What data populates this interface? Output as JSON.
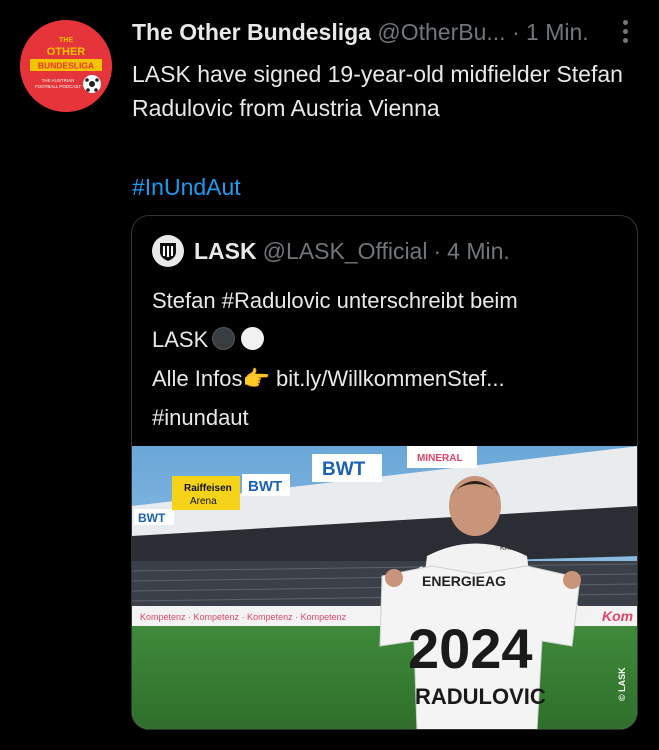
{
  "tweet": {
    "author_name": "The Other Bundesliga",
    "handle": "@OtherBu...",
    "separator": "·",
    "time": "1 Min.",
    "text": "LASK have signed 19-year-old midfielder Stefan Radulovic from Austria Vienna",
    "hashtag": "#InUndAut",
    "avatar_logo": {
      "line1": "THE",
      "line2": "OTHER",
      "line3": "BUNDESLIGA",
      "line4": "THE AUSTRIAN",
      "line5": "FOOTBALL PODCAST"
    }
  },
  "quoted": {
    "author_name": "LASK",
    "handle": "@LASK_Official",
    "separator": "·",
    "time": "4 Min.",
    "line1": "Stefan #Radulovic unterschreibt beim",
    "line2": "LASK",
    "line3_prefix": "Alle Infos",
    "pointing_emoji": "👉",
    "link": "bit.ly/WillkommenStef...",
    "line4": "#inundaut",
    "photo": {
      "sponsor_bwt": "BWT",
      "sponsor_raiffeisen_1": "Raiffeisen",
      "sponsor_raiffeisen_2": "Arena",
      "sponsor_minera": "MINERAL",
      "sponsor_kompetenz": "Kom",
      "shirt_sponsor": "ENERGIEAG",
      "shirt_year": "2024",
      "shirt_name": "RADULOVIC",
      "shirt_brand": "KARL",
      "copyright": "© LASK"
    }
  },
  "colors": {
    "background": "#000000",
    "text": "#e7e9ea",
    "secondary": "#71767b",
    "link": "#1d9bf0",
    "border": "#2f3336",
    "avatar_red": "#e5343a"
  }
}
